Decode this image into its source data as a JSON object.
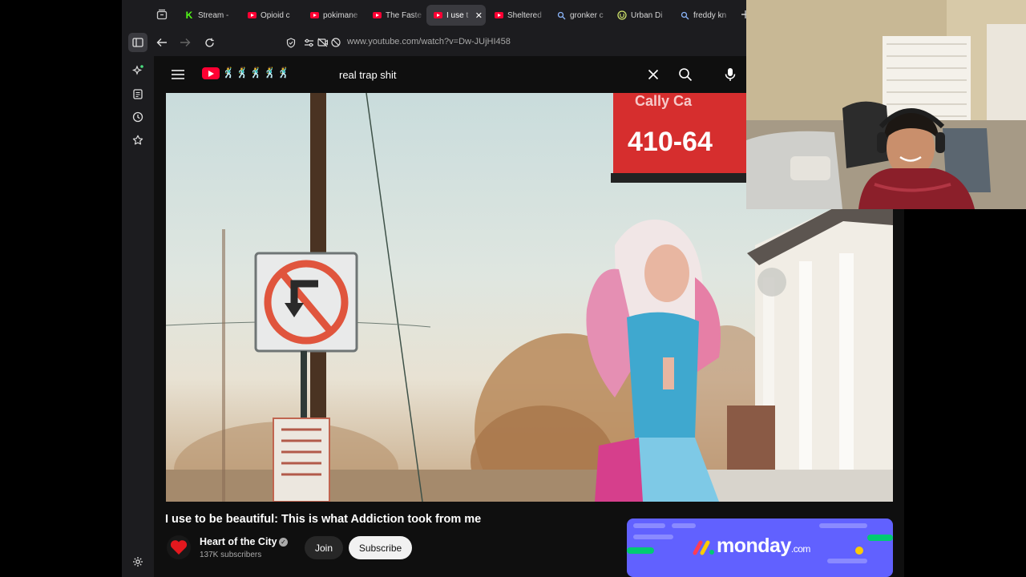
{
  "tabs": [
    {
      "title": "Stream -",
      "favicon": "kick-icon",
      "active": false
    },
    {
      "title": "Opioid c",
      "favicon": "youtube-icon",
      "active": false
    },
    {
      "title": "pokimane",
      "favicon": "youtube-icon",
      "active": false
    },
    {
      "title": "The Faste",
      "favicon": "youtube-icon",
      "active": false
    },
    {
      "title": "I use t",
      "favicon": "youtube-icon",
      "active": true
    },
    {
      "title": "Sheltered",
      "favicon": "youtube-icon",
      "active": false
    },
    {
      "title": "gronker c",
      "favicon": "search-icon",
      "active": false
    },
    {
      "title": "Urban Di",
      "favicon": "urban-dictionary-icon",
      "active": false
    },
    {
      "title": "freddy kn",
      "favicon": "search-icon",
      "active": false
    }
  ],
  "toolbar": {
    "url": "www.youtube.com/watch?v=Dw-JUjHI458"
  },
  "youtube": {
    "logo_emoji_text": "🕺🕺🕺🕺🕺",
    "search_query": "real trap shit"
  },
  "video": {
    "title": "I use to be beautiful: This is what Addiction took from me",
    "sign_text": "410-64",
    "sign_text_top": "Cally Ca",
    "channel_name": "Heart of the City",
    "subscribers": "137K subscribers",
    "join_label": "Join",
    "subscribe_label": "Subscribe"
  },
  "ad": {
    "brand": "monday",
    "suffix": ".com"
  },
  "colors": {
    "accent_red": "#ff0033",
    "ad_purple": "#6161ff",
    "kick_green": "#53fc18"
  }
}
